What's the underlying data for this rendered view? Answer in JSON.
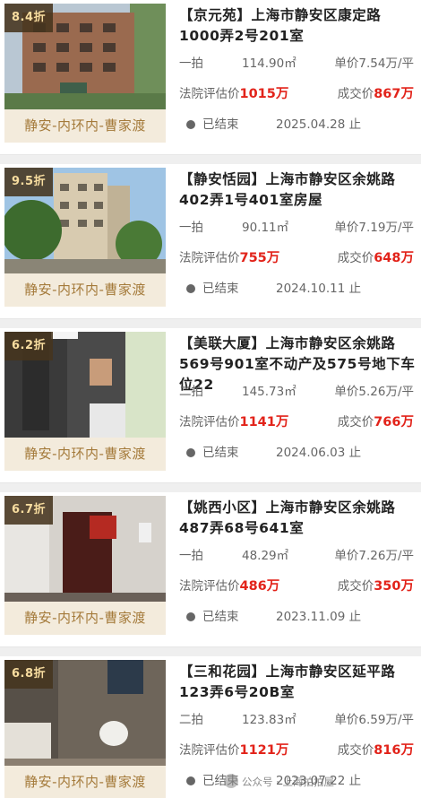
{
  "listings": [
    {
      "discount": "8.4折",
      "location_tag": "静安-内环内-曹家渡",
      "title": "【京元苑】上海市静安区康定路1000弄2号201室",
      "round": "一拍",
      "area": "114.90㎡",
      "unit_price": "单价7.54万/平",
      "appraisal_label": "法院评估价",
      "appraisal_value": "1015万",
      "deal_label": "成交价",
      "deal_value": "867万",
      "status": "已结束",
      "end_date": "2025.04.28 止"
    },
    {
      "discount": "9.5折",
      "location_tag": "静安-内环内-曹家渡",
      "title": "【静安恬园】上海市静安区余姚路402弄1号401室房屋",
      "round": "一拍",
      "area": "90.11㎡",
      "unit_price": "单价7.19万/平",
      "appraisal_label": "法院评估价",
      "appraisal_value": "755万",
      "deal_label": "成交价",
      "deal_value": "648万",
      "status": "已结束",
      "end_date": "2024.10.11 止"
    },
    {
      "discount": "6.2折",
      "location_tag": "静安-内环内-曹家渡",
      "title": "【美联大厦】上海市静安区余姚路569号901室不动产及575号地下车位22",
      "round": "二拍",
      "area": "145.73㎡",
      "unit_price": "单价5.26万/平",
      "appraisal_label": "法院评估价",
      "appraisal_value": "1141万",
      "deal_label": "成交价",
      "deal_value": "766万",
      "status": "已结束",
      "end_date": "2024.06.03 止"
    },
    {
      "discount": "6.7折",
      "location_tag": "静安-内环内-曹家渡",
      "title": "【姚西小区】上海市静安区余姚路487弄68号641室",
      "round": "一拍",
      "area": "48.29㎡",
      "unit_price": "单价7.26万/平",
      "appraisal_label": "法院评估价",
      "appraisal_value": "486万",
      "deal_label": "成交价",
      "deal_value": "350万",
      "status": "已结束",
      "end_date": "2023.11.09 止"
    },
    {
      "discount": "6.8折",
      "location_tag": "静安-内环内-曹家渡",
      "title": "【三和花园】上海市静安区延平路123弄6号20B室",
      "round": "二拍",
      "area": "123.83㎡",
      "unit_price": "单价6.59万/平",
      "appraisal_label": "法院评估价",
      "appraisal_value": "1121万",
      "deal_label": "成交价",
      "deal_value": "816万",
      "status": "已结束",
      "end_date": "2023.07.22 止"
    }
  ],
  "watermark": "公众号 · 上海拍拍屋"
}
